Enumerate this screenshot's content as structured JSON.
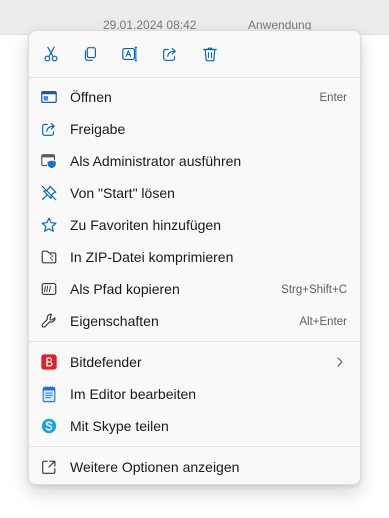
{
  "background": {
    "date_modified": "29.01.2024 08:42",
    "type": "Anwendung"
  },
  "toolbar": {
    "buttons": [
      {
        "name": "cut",
        "icon": "scissors-icon"
      },
      {
        "name": "copy",
        "icon": "copy-icon"
      },
      {
        "name": "rename",
        "icon": "rename-icon"
      },
      {
        "name": "share",
        "icon": "share-icon"
      },
      {
        "name": "delete",
        "icon": "trash-icon"
      }
    ]
  },
  "menu": {
    "open": {
      "label": "Öffnen",
      "shortcut": "Enter",
      "icon": "window-icon"
    },
    "share": {
      "label": "Freigabe",
      "icon": "share-icon"
    },
    "run_as_admin": {
      "label": "Als Administrator ausführen",
      "icon": "admin-shield-icon"
    },
    "unpin_start": {
      "label": "Von \"Start\" lösen",
      "icon": "unpin-icon"
    },
    "add_favorites": {
      "label": "Zu Favoriten hinzufügen",
      "icon": "star-icon"
    },
    "compress_zip": {
      "label": "In ZIP-Datei komprimieren",
      "icon": "zip-folder-icon"
    },
    "copy_path": {
      "label": "Als Pfad kopieren",
      "shortcut": "Strg+Shift+C",
      "icon": "copy-path-icon"
    },
    "properties": {
      "label": "Eigenschaften",
      "shortcut": "Alt+Enter",
      "icon": "wrench-icon"
    },
    "bitdefender": {
      "label": "Bitdefender",
      "icon": "bitdefender-icon",
      "has_submenu": true
    },
    "edit_in_editor": {
      "label": "Im Editor bearbeiten",
      "icon": "notepad-icon"
    },
    "share_skype": {
      "label": "Mit Skype teilen",
      "icon": "skype-icon"
    },
    "more_options": {
      "label": "Weitere Optionen anzeigen",
      "icon": "expand-icon"
    }
  },
  "colors": {
    "accent": "#0067c0",
    "bitdefender_red": "#e2202a",
    "skype_blue": "#1aa3e8",
    "menu_background": "#f9f9f9"
  }
}
